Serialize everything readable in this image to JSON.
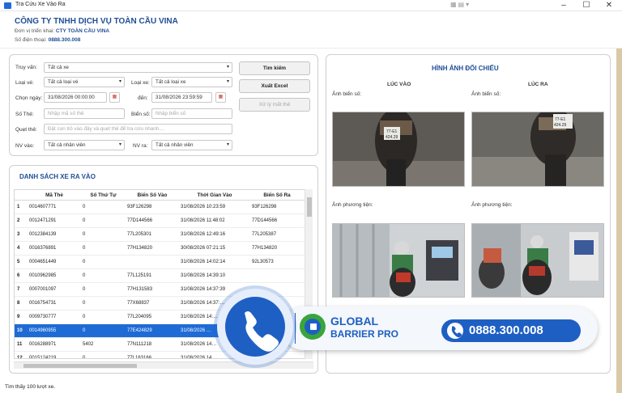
{
  "window": {
    "title": "Tra Cứu Xe Vào Ra",
    "system_icons": "▦▤▾"
  },
  "header": {
    "company": "CÔNG TY TNHH DỊCH VỤ TOÀN CẦU VINA",
    "deploy_label": "Đơn vị triển khai:",
    "deploy_value": "CTY TOÀN CẦU VINA",
    "phone_label": "Số điện thoại:",
    "phone_value": "0888.300.008"
  },
  "search": {
    "query_label": "Truy vấn:",
    "query_value": "Tất cả xe",
    "ticket_type_label": "Loại vé:",
    "ticket_type_value": "Tất cả loại vé",
    "vehicle_type_label": "Loại xe:",
    "vehicle_type_value": "Tất cả loại xe",
    "date_from_label": "Chọn ngày:",
    "date_from_value": "31/08/2026 00:00:00",
    "date_to_label": "đến:",
    "date_to_value": "31/08/2026 23:59:59",
    "card_no_label": "Số Thẻ:",
    "card_no_placeholder": "Nhập mã số thẻ",
    "plate_label": "Biển số:",
    "plate_placeholder": "Nhập biển số",
    "scan_label": "Quẹt thẻ:",
    "scan_placeholder": "Đặt con trỏ vào đây và quẹt thẻ để tra cứu nhanh....",
    "staff_in_label": "NV vào:",
    "staff_in_value": "Tất cả nhân viên",
    "staff_out_label": "NV ra:",
    "staff_out_value": "Tất cả nhân viên",
    "search_button": "Tìm kiếm",
    "export_button": "Xuất Excel",
    "handle_lost_button": "Xử lý mất thẻ"
  },
  "list": {
    "title": "DANH SÁCH XE RA VÀO",
    "columns": [
      "",
      "Mã Thẻ",
      "Số Thứ Tự",
      "Biển Số Vào",
      "Thời Gian Vào",
      "Biển Số Ra"
    ],
    "selected_row": 9,
    "rows": [
      [
        "1",
        "0014607771",
        "0",
        "93F126298",
        "31/08/2026 10:23:59",
        "93F126298"
      ],
      [
        "2",
        "0012471291",
        "0",
        "77D144566",
        "31/08/2026 11:48:02",
        "77D144566"
      ],
      [
        "3",
        "0012384139",
        "0",
        "77L205301",
        "31/08/2026 12:49:16",
        "77L205387"
      ],
      [
        "4",
        "0016376891",
        "0",
        "77H134820",
        "30/08/2026 07:21:15",
        "77H134820"
      ],
      [
        "5",
        "0004651449",
        "0",
        "",
        "31/08/2026 14:02:14",
        "92L30573"
      ],
      [
        "6",
        "0010962985",
        "0",
        "77L125191",
        "31/08/2026 14:39:10",
        ""
      ],
      [
        "7",
        "0007001097",
        "0",
        "77H131583",
        "31/08/2026 14:37:39",
        ""
      ],
      [
        "8",
        "0016754731",
        "0",
        "77X68837",
        "31/08/2026 14:37:…",
        ""
      ],
      [
        "9",
        "0009730777",
        "0",
        "77L204095",
        "31/08/2026 14:…",
        ""
      ],
      [
        "10",
        "0014960955",
        "0",
        "77E424829",
        "31/08/2026 …",
        ""
      ],
      [
        "11",
        "0016288971",
        "5402",
        "77N111218",
        "31/08/2026 14…",
        ""
      ],
      [
        "12",
        "0015124219",
        "0",
        "77L163166",
        "31/08/2026 14…",
        ""
      ]
    ]
  },
  "compare": {
    "title": "HÌNH ẢNH ĐỐI CHIẾU",
    "in_label": "LÚC VÀO",
    "out_label": "LÚC RA",
    "plate_img_label": "Ảnh biển số:",
    "vehicle_img_label": "Ảnh phương tiện:",
    "plate_in_text": "77-E1\n424.29",
    "plate_out_text": "77-E1\n424.29"
  },
  "ad": {
    "brand_line1": "GLOBAL",
    "brand_line2": "BARRIER PRO",
    "phone": "0888.300.008"
  },
  "status": "Tìm thấy 100 lượt xe.",
  "colors": {
    "accent": "#1f4e96",
    "selection": "#1e6bd6",
    "ad_blue": "#1e5fc4",
    "ad_green": "#3aa53a"
  }
}
